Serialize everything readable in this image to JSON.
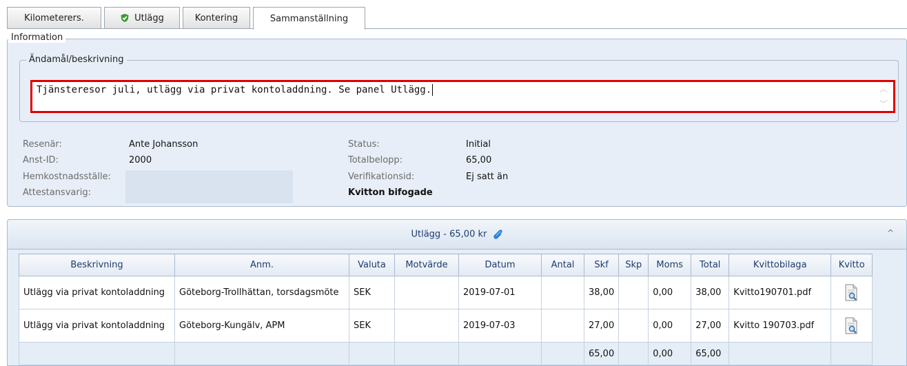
{
  "tabs": [
    {
      "label": "Kilometerers."
    },
    {
      "label": "Utlägg",
      "icon": "shield-check-icon"
    },
    {
      "label": "Kontering"
    },
    {
      "label": "Sammanställning",
      "active": true
    }
  ],
  "information": {
    "legend": "Information",
    "description_legend": "Ändamål/beskrivning",
    "description_value": "Tjänsteresor juli, utlägg via privat kontoladdning. Se panel Utlägg.",
    "fields": {
      "resenar_label": "Resenär:",
      "resenar_value": "Ante Johansson",
      "anst_label": "Anst-ID:",
      "anst_value": "2000",
      "hemkost_label": "Hemkostnadsställe:",
      "hemkost_value": "",
      "attest_label": "Attestansvarig:",
      "attest_value": "",
      "status_label": "Status:",
      "status_value": "Initial",
      "total_label": "Totalbelopp:",
      "total_value": "65,00",
      "verif_label": "Verifikationsid:",
      "verif_value": "Ej satt än",
      "kvitton": "Kvitton bifogade"
    }
  },
  "utlagg": {
    "title": "Utlägg - 65,00 kr",
    "columns": [
      "Beskrivning",
      "Anm.",
      "Valuta",
      "Motvärde",
      "Datum",
      "Antal",
      "Skf",
      "Skp",
      "Moms",
      "Total",
      "Kvittobilaga",
      "Kvitto"
    ],
    "rows": [
      {
        "beskrivning": "Utlägg via privat kontoladdning",
        "anm": "Göteborg-Trollhättan, torsdagsmöte",
        "valuta": "SEK",
        "motvarde": "",
        "datum": "2019-07-01",
        "antal": "",
        "skf": "38,00",
        "skp": "",
        "moms": "0,00",
        "total": "38,00",
        "kvittobilaga": "Kvitto190701.pdf"
      },
      {
        "beskrivning": "Utlägg via privat kontoladdning",
        "anm": "Göteborg-Kungälv, APM",
        "valuta": "SEK",
        "motvarde": "",
        "datum": "2019-07-03",
        "antal": "",
        "skf": "27,00",
        "skp": "",
        "moms": "0,00",
        "total": "27,00",
        "kvittobilaga": "Kvitto 190703.pdf"
      }
    ],
    "summary": {
      "skf": "65,00",
      "moms": "0,00",
      "total": "65,00"
    }
  },
  "colors": {
    "highlight": "#e10000",
    "panel_bg": "#e8eef7",
    "header_text": "#1d3b6e"
  }
}
